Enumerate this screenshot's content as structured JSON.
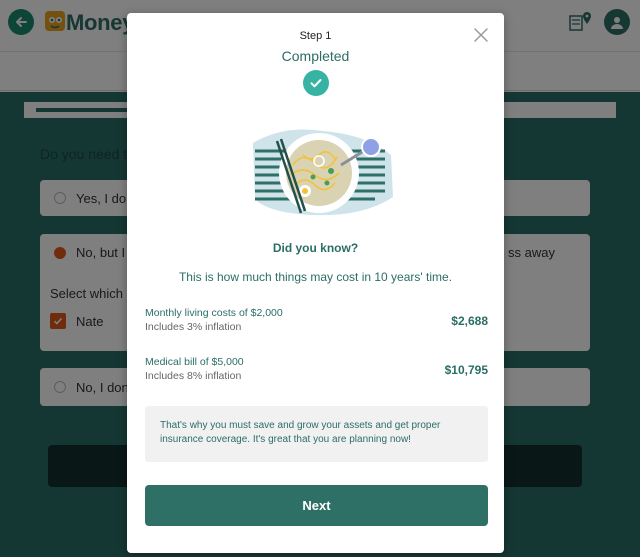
{
  "header": {
    "brand": "Money",
    "icons": [
      "back-arrow-icon",
      "logo-icon",
      "map-pin-icon",
      "user-icon"
    ]
  },
  "background": {
    "question": "Do you need t",
    "options": [
      {
        "label": "Yes, I do"
      },
      {
        "label": "No, but I",
        "trailing": "ss away"
      },
      {
        "label": "No, I don"
      }
    ],
    "select_which": "Select which d",
    "checkbox_label": "Nate",
    "progress_fraction": 0.5
  },
  "modal": {
    "step": "Step 1",
    "status": "Completed",
    "heading": "Did you know?",
    "intro": "This is how much things may cost in 10 years' time.",
    "costs": [
      {
        "title": "Monthly living costs of $2,000",
        "sub": "Includes 3% inflation",
        "value": "$2,688"
      },
      {
        "title": "Medical bill of $5,000",
        "sub": "Includes 8% inflation",
        "value": "$10,795"
      }
    ],
    "note": "That's why you must save and grow your assets and get proper insurance coverage. It's great that you are planning now!",
    "next_label": "Next"
  },
  "colors": {
    "primary": "#2e6f66",
    "accent": "#37b3a4",
    "orange": "#e05a1a"
  }
}
